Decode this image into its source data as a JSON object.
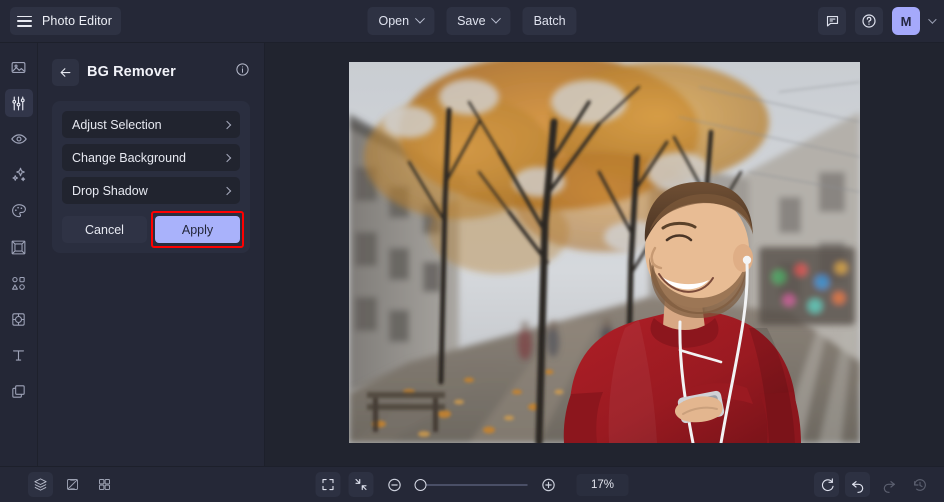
{
  "app": {
    "name": "Photo Editor",
    "accent": "#a9b2fb",
    "highlight": "#ff0000",
    "bg": "#252837",
    "canvas_bg": "#21242f"
  },
  "topbar": {
    "menu_icon": "hamburger-icon",
    "brand": "Photo Editor",
    "center_buttons": [
      {
        "label": "Open",
        "has_caret": true
      },
      {
        "label": "Save",
        "has_caret": true
      },
      {
        "label": "Batch",
        "has_caret": false
      }
    ],
    "right_icons": [
      {
        "name": "feedback-icon"
      },
      {
        "name": "help-icon"
      }
    ],
    "avatar": {
      "initial": "M",
      "color": "#a5a9fb"
    }
  },
  "sidebar": {
    "items": [
      {
        "name": "image-icon",
        "label": "Image",
        "active": false
      },
      {
        "name": "adjust-sliders-icon",
        "label": "Adjust",
        "active": true
      },
      {
        "name": "eye-icon",
        "label": "Preview",
        "active": false
      },
      {
        "name": "sparkles-icon",
        "label": "Effects",
        "active": false
      },
      {
        "name": "palette-icon",
        "label": "Color",
        "active": false
      },
      {
        "name": "frame-icon",
        "label": "Frame",
        "active": false
      },
      {
        "name": "shapes-icon",
        "label": "Shapes",
        "active": false
      },
      {
        "name": "transform-icon",
        "label": "Transform",
        "active": false
      },
      {
        "name": "text-icon",
        "label": "Text",
        "active": false
      },
      {
        "name": "layers-stack-icon",
        "label": "Layers",
        "active": false
      }
    ]
  },
  "panel": {
    "back_icon": "arrow-left-icon",
    "title": "BG Remover",
    "info_icon": "info-icon",
    "rows": [
      {
        "label": "Adjust Selection"
      },
      {
        "label": "Change Background"
      },
      {
        "label": "Drop Shadow"
      }
    ],
    "cancel_label": "Cancel",
    "apply_label": "Apply",
    "apply_highlighted": true
  },
  "canvas": {
    "image_alt": "Smiling man in red sweater with earphones on an autumn city street"
  },
  "bottombar": {
    "left_tools": [
      {
        "name": "layers-icon",
        "filled": true
      },
      {
        "name": "compare-icon",
        "filled": false
      },
      {
        "name": "grid-icon",
        "filled": false
      }
    ],
    "center_tools": [
      {
        "name": "fit-screen-icon",
        "filled": true
      },
      {
        "name": "fit-contract-icon",
        "filled": true
      },
      {
        "name": "zoom-out-icon",
        "filled": false
      }
    ],
    "zoom_in_icon": "zoom-in-icon",
    "zoom_level": "17%",
    "slider_position_pct": 0,
    "right_tools": [
      {
        "name": "reset-rotate-icon",
        "filled": true,
        "dim": false
      },
      {
        "name": "undo-icon",
        "filled": true,
        "dim": false
      },
      {
        "name": "redo-icon",
        "filled": false,
        "dim": true
      },
      {
        "name": "history-icon",
        "filled": false,
        "dim": true
      }
    ]
  }
}
